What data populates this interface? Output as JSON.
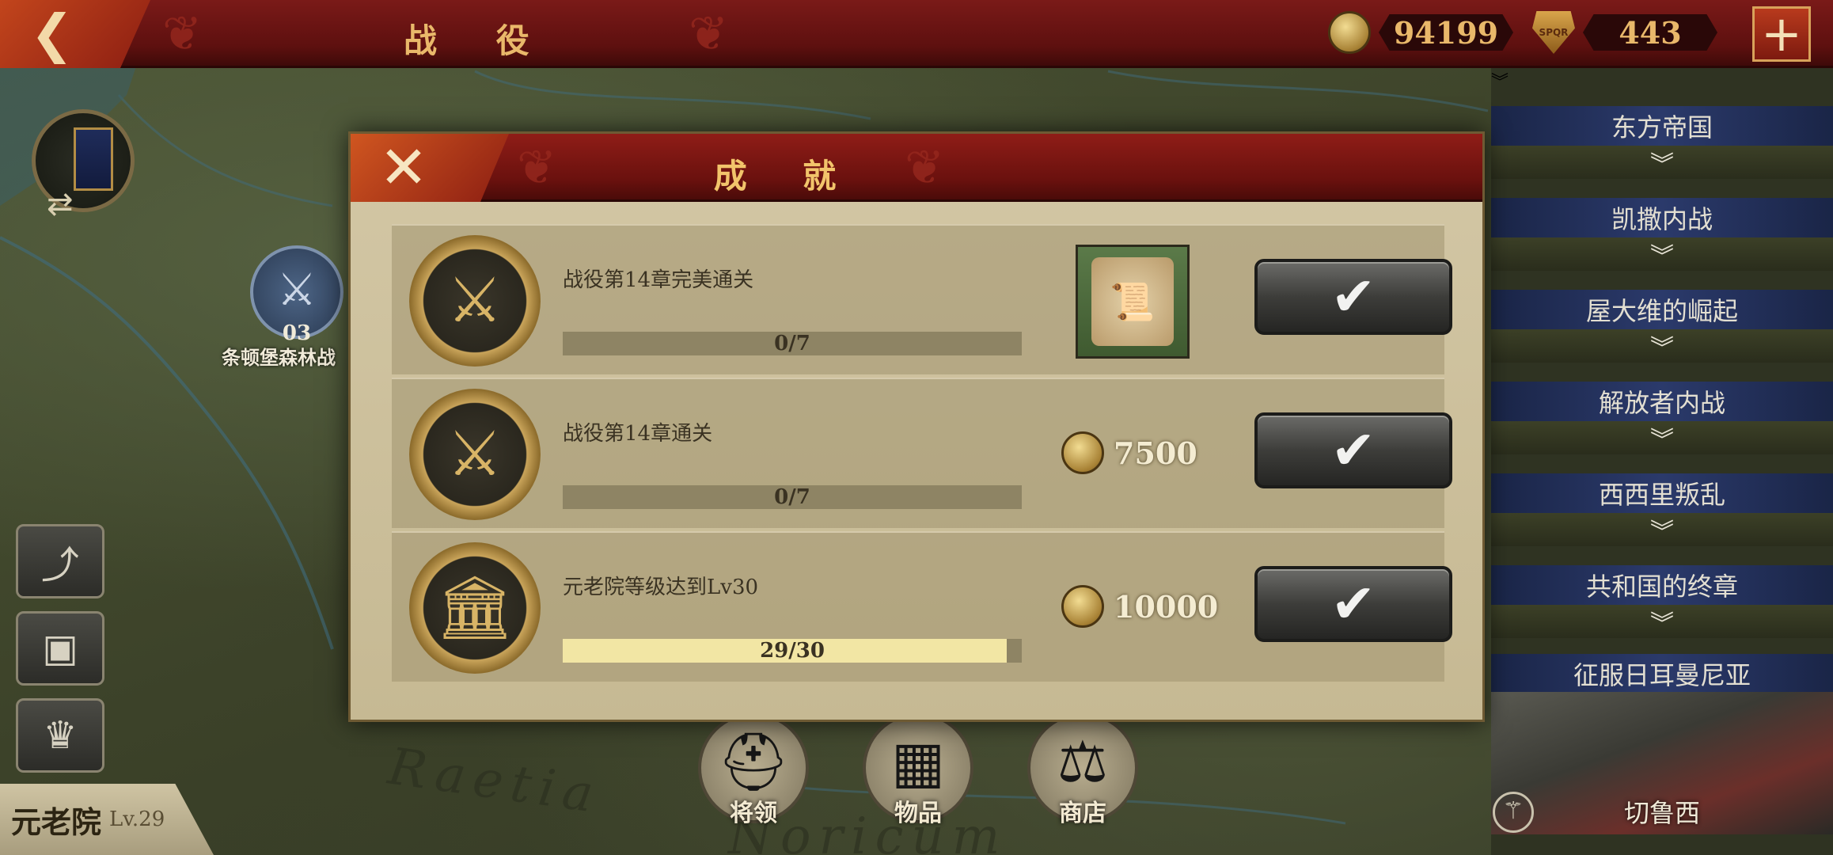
{
  "header": {
    "back_icon": "back-arrow-icon",
    "title": "战 役",
    "coins": "94199",
    "spqr_points": "443",
    "plus_label": "+"
  },
  "map": {
    "battle_node_number": "03",
    "battle_node_label": "条顿堡森林战",
    "region_text_1": "Raetia",
    "region_text_2": "Noricum"
  },
  "left_panel": {
    "senate_name": "元老院",
    "senate_level": "Lv.29"
  },
  "bottom_nav": {
    "generals": "将领",
    "items": "物品",
    "shop": "商店"
  },
  "chapters": [
    {
      "title": "东方帝国"
    },
    {
      "title": "凯撒内战"
    },
    {
      "title": "屋大维的崛起"
    },
    {
      "title": "解放者内战"
    },
    {
      "title": "西西里叛乱"
    },
    {
      "title": "共和国的终章"
    },
    {
      "title": "征服日耳曼尼亚"
    }
  ],
  "chapter_current_caption": "切鲁西",
  "modal": {
    "title": "成 就",
    "rows": [
      {
        "label": "战役第14章完美通关",
        "progress_text": "0/7",
        "progress": 0.0,
        "reward_type": "scroll"
      },
      {
        "label": "战役第14章通关",
        "progress_text": "0/7",
        "progress": 0.0,
        "reward_type": "coin",
        "reward_amount": "7500"
      },
      {
        "label": "元老院等级达到Lv30",
        "progress_text": "29/30",
        "progress": 0.9667,
        "reward_type": "coin",
        "reward_amount": "10000"
      }
    ]
  },
  "colors": {
    "header_red": "#6a110e",
    "accent_gold": "#f2c46b",
    "parchment": "#d3c7a5",
    "chapter_blue": "#2b3a6b",
    "progress_fill": "#f2e6a4"
  }
}
